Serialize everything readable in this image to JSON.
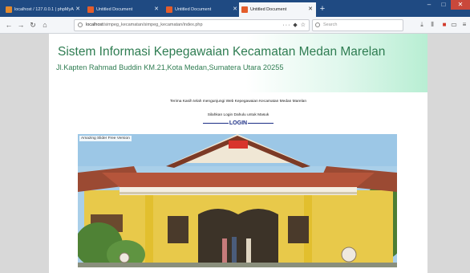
{
  "tabs": [
    {
      "label": "localhost / 127.0.0.1 | phpMyA",
      "color": "#e28a2e",
      "active": false
    },
    {
      "label": "Untitled Document",
      "color": "#e45d2b",
      "active": false
    },
    {
      "label": "Untitled Document",
      "color": "#e45d2b",
      "active": false
    },
    {
      "label": "Untitled Document",
      "color": "#e45d2b",
      "active": true
    }
  ],
  "browser": {
    "url_host": "localhost",
    "url_path": "/simpeg_kecamatan/simpeg_kecamatan/index.php",
    "search_placeholder": "Search"
  },
  "site": {
    "title": "Sistem Informasi Kepegawaian Kecamatan Medan Marelan",
    "address": "Jl.Kapten Rahmad Buddin KM.21,Kota Medan,Sumatera Utara 20255",
    "welcome": "Terima Kasih telah mengunjungi Web Kepegawaian Kecamatan Medan Marelan",
    "login_note": "Silahkan Login Dahulu untuk Masuk",
    "login_heading": "LOGIN"
  },
  "slider": {
    "label": "Amazing Slider Free Version"
  },
  "colors": {
    "title_green": "#2f7d52",
    "login_blue": "#1c2f86",
    "tabbar": "#1f4a82"
  }
}
